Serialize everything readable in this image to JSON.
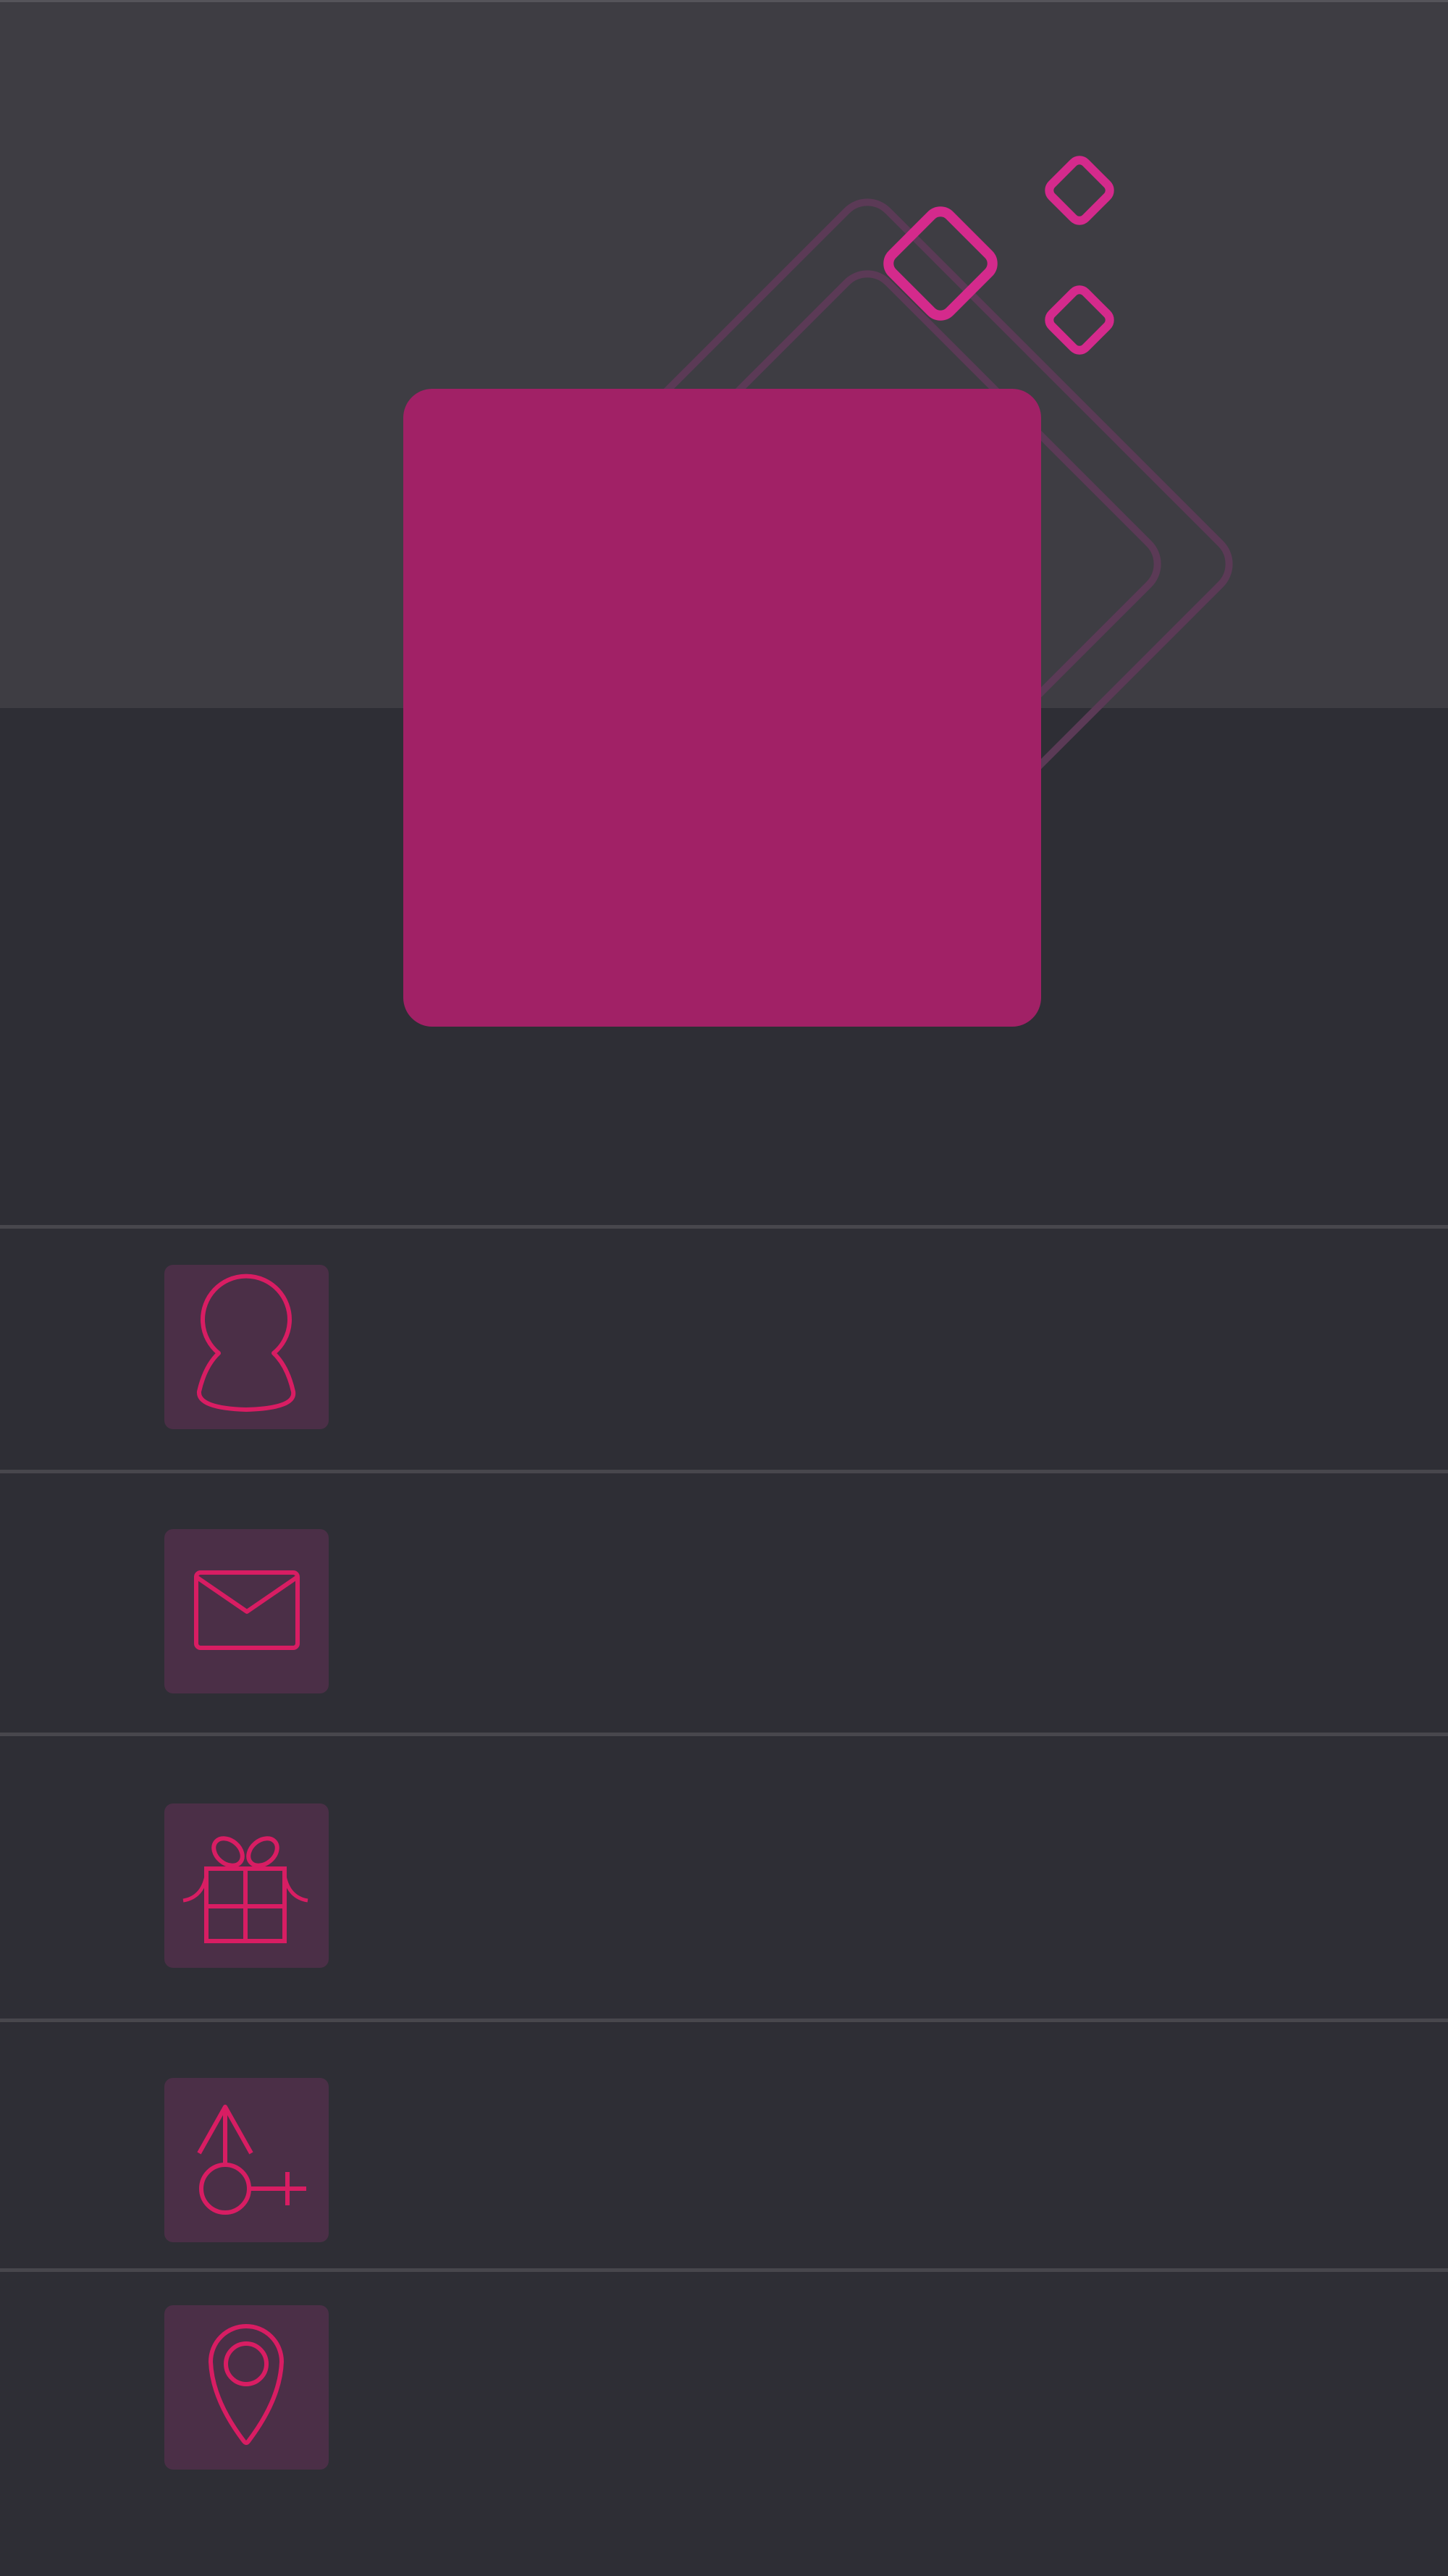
{
  "profile": {
    "name": "",
    "email": "",
    "birthday": "",
    "gender": "",
    "location": ""
  },
  "colors": {
    "background": "#2e2e35",
    "header_background": "#3e3d43",
    "accent": "#a12166",
    "icon_stroke": "#d81d63",
    "icon_tile": "#4b2f47",
    "divider": "#48474d"
  },
  "icons": {
    "avatar": "avatar-placeholder",
    "decor": "diamond-outline",
    "rows": [
      "person-icon",
      "mail-icon",
      "gift-icon",
      "gender-icon",
      "location-pin-icon"
    ]
  }
}
